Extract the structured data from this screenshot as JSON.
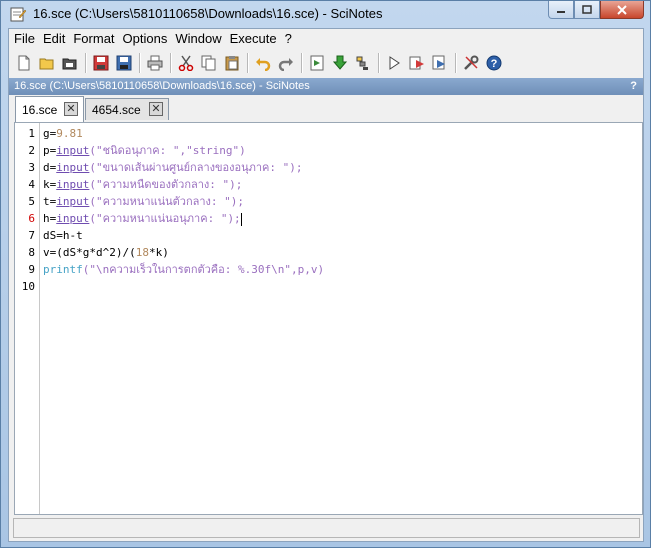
{
  "window": {
    "title": "16.sce (C:\\Users\\5810110658\\Downloads\\16.sce) - SciNotes"
  },
  "menu": [
    "File",
    "Edit",
    "Format",
    "Options",
    "Window",
    "Execute",
    "?"
  ],
  "toolbar_icons": [
    "new-file-icon",
    "open-file-icon",
    "open-recent-icon",
    "save-icon",
    "save-as-icon",
    "print-icon",
    "cut-icon",
    "copy-icon",
    "paste-icon",
    "undo-icon",
    "redo-icon",
    "execute-file-icon",
    "load-icon",
    "exec-icon",
    "run-icon",
    "step-icon",
    "run-all-icon",
    "settings-icon",
    "help-icon"
  ],
  "doc_header": {
    "path": "16.sce (C:\\Users\\5810110658\\Downloads\\16.sce) - SciNotes",
    "help": "?"
  },
  "tabs": [
    {
      "label": "16.sce",
      "active": true
    },
    {
      "label": "4654.sce",
      "active": false
    }
  ],
  "line_numbers": [
    "1",
    "2",
    "3",
    "4",
    "5",
    "6",
    "7",
    "8",
    "9",
    "10"
  ],
  "code": {
    "l1": {
      "a": "g=",
      "b": "9.81"
    },
    "l2": {
      "a": "p=",
      "b": "input",
      "c": "(\"ชนิดอนุภาค: \",\"string\")"
    },
    "l3": {
      "a": "d=",
      "b": "input",
      "c": "(\"ขนาดเส้นผ่านศูนย์กลางของอนุภาค: \");"
    },
    "l4": {
      "a": "k=",
      "b": "input",
      "c": "(\"ความหนืดของตัวกลาง: \");"
    },
    "l5": {
      "a": "t=",
      "b": "input",
      "c": "(\"ความหนาแน่นตัวกลาง: \");"
    },
    "l6": {
      "a": "h=",
      "b": "input",
      "c": "(\"ความหนาแน่นอนุภาค: \");"
    },
    "l7": {
      "a": "dS=h-t"
    },
    "l8": {
      "a": "v=(dS*g*d^2)/(",
      "b": "18",
      "c": "*k)"
    },
    "l9": {
      "a": "printf",
      "b": "(\"\\nความเร็วในการตกตัวคือ: %.30f\\n\",p,v)"
    }
  },
  "colors": {
    "titlebar": "#b9d1ea",
    "doc_header": "#7f9ec5",
    "keyword": "#6f4cb0",
    "string": "#9a6fbf",
    "number": "#b1885d",
    "error_line": "#d00000"
  }
}
